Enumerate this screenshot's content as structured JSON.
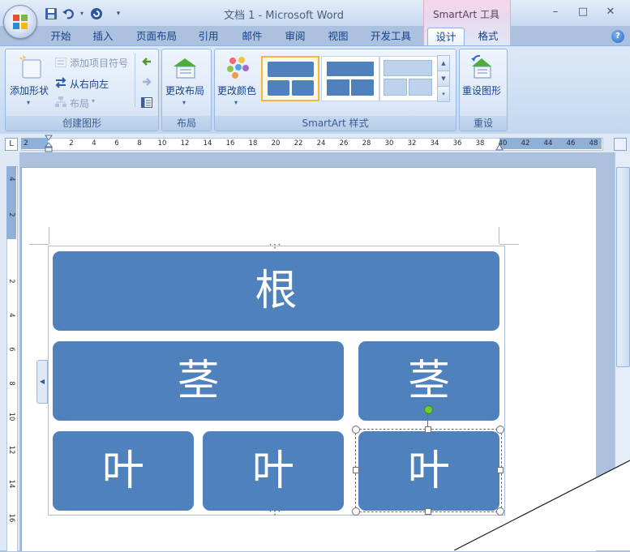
{
  "titlebar": {
    "title": "文档 1 - Microsoft Word",
    "contextual_tab": "SmartArt 工具",
    "window_buttons": {
      "minimize": "–",
      "maximize": "□",
      "close": "✕"
    },
    "quick_access": {
      "more": "▾",
      "undo_dropdown": "▾"
    }
  },
  "tabs": [
    {
      "label": "开始"
    },
    {
      "label": "插入"
    },
    {
      "label": "页面布局"
    },
    {
      "label": "引用"
    },
    {
      "label": "邮件"
    },
    {
      "label": "审阅"
    },
    {
      "label": "视图"
    },
    {
      "label": "开发工具"
    },
    {
      "label": "设计",
      "active": true
    },
    {
      "label": "格式"
    }
  ],
  "help_icon": "?",
  "ribbon": {
    "groups": {
      "create_graphic": {
        "label": "创建图形",
        "add_shape": "添加形状",
        "add_bullet": "添加项目符号",
        "right_to_left": "从右向左",
        "layout": "布局"
      },
      "layouts": {
        "label": "布局",
        "change_layout": "更改布局"
      },
      "smartart_styles": {
        "label": "SmartArt 样式",
        "change_colors": "更改颜色"
      },
      "reset": {
        "label": "重设",
        "reset_graphic": "重设图形"
      }
    }
  },
  "ruler": {
    "tab_selector": "L",
    "ticks": [
      "2",
      "2",
      "4",
      "6",
      "8",
      "10",
      "12",
      "14",
      "16",
      "18",
      "20",
      "22",
      "24",
      "26",
      "28",
      "30",
      "32",
      "34",
      "36",
      "38",
      "40",
      "42",
      "44",
      "46",
      "48"
    ],
    "vticks": [
      "4",
      "2",
      "2",
      "4",
      "6",
      "8",
      "10",
      "12",
      "14",
      "16",
      "18"
    ]
  },
  "smartart": {
    "root": "根",
    "stems": [
      "茎",
      "茎"
    ],
    "leaves": [
      "叶",
      "叶",
      "叶"
    ],
    "node_color": "#4f81bd"
  },
  "colors": {
    "accent": "#4f81bd",
    "ribbon": "#dde9f7",
    "workspace": "#abc1de"
  }
}
